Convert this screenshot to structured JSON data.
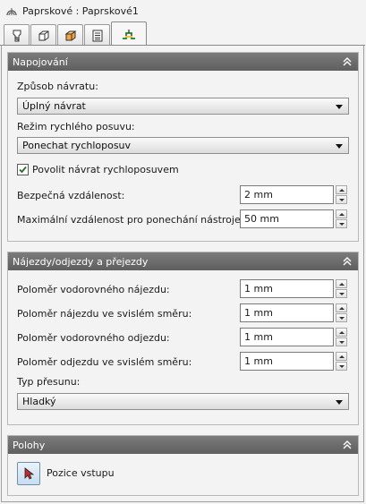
{
  "window": {
    "title": "Paprskové : Paprskové1",
    "icon": "toolpath-arc-icon"
  },
  "tabs": [
    {
      "name": "tool-icon",
      "active": false
    },
    {
      "name": "box-icon",
      "active": false
    },
    {
      "name": "stock-box-icon",
      "active": false
    },
    {
      "name": "pages-icon",
      "active": false
    },
    {
      "name": "linking-icon",
      "active": true
    }
  ],
  "napojovani": {
    "title": "Napojování",
    "return_label": "Způsob návratu:",
    "return_value": "Úplný návrat",
    "rapid_label": "Režim rychlého posuvu:",
    "rapid_value": "Ponechat rychloposuv",
    "allow_return_label": "Povolit návrat rychloposuvem",
    "allow_return_checked": true,
    "safe_label": "Bezpečná vzdálenost:",
    "safe_value": "2 mm",
    "maxdist_label": "Maximální vzdálenost pro ponechání nástroje dole:",
    "maxdist_value": "50 mm"
  },
  "najezdy": {
    "title": "Nájezdy/odjezdy a přejezdy",
    "h_lead_in_label": "Poloměr vodorovného nájezdu:",
    "h_lead_in_value": "1 mm",
    "v_lead_in_label": "Poloměr nájezdu ve svislém směru:",
    "v_lead_in_value": "1 mm",
    "h_lead_out_label": "Poloměr vodorovného odjezdu:",
    "h_lead_out_value": "1 mm",
    "v_lead_out_label": "Poloměr odjezdu ve svislém směru:",
    "v_lead_out_value": "1 mm",
    "transfer_label": "Typ přesunu:",
    "transfer_value": "Hladký"
  },
  "polohy": {
    "title": "Polohy",
    "entry_label": "Pozice vstupu"
  },
  "colors": {
    "header_bg": "#6b6b6b",
    "panel_bg": "#f3f3f3",
    "checkbox_check": "#2d6a2d"
  }
}
